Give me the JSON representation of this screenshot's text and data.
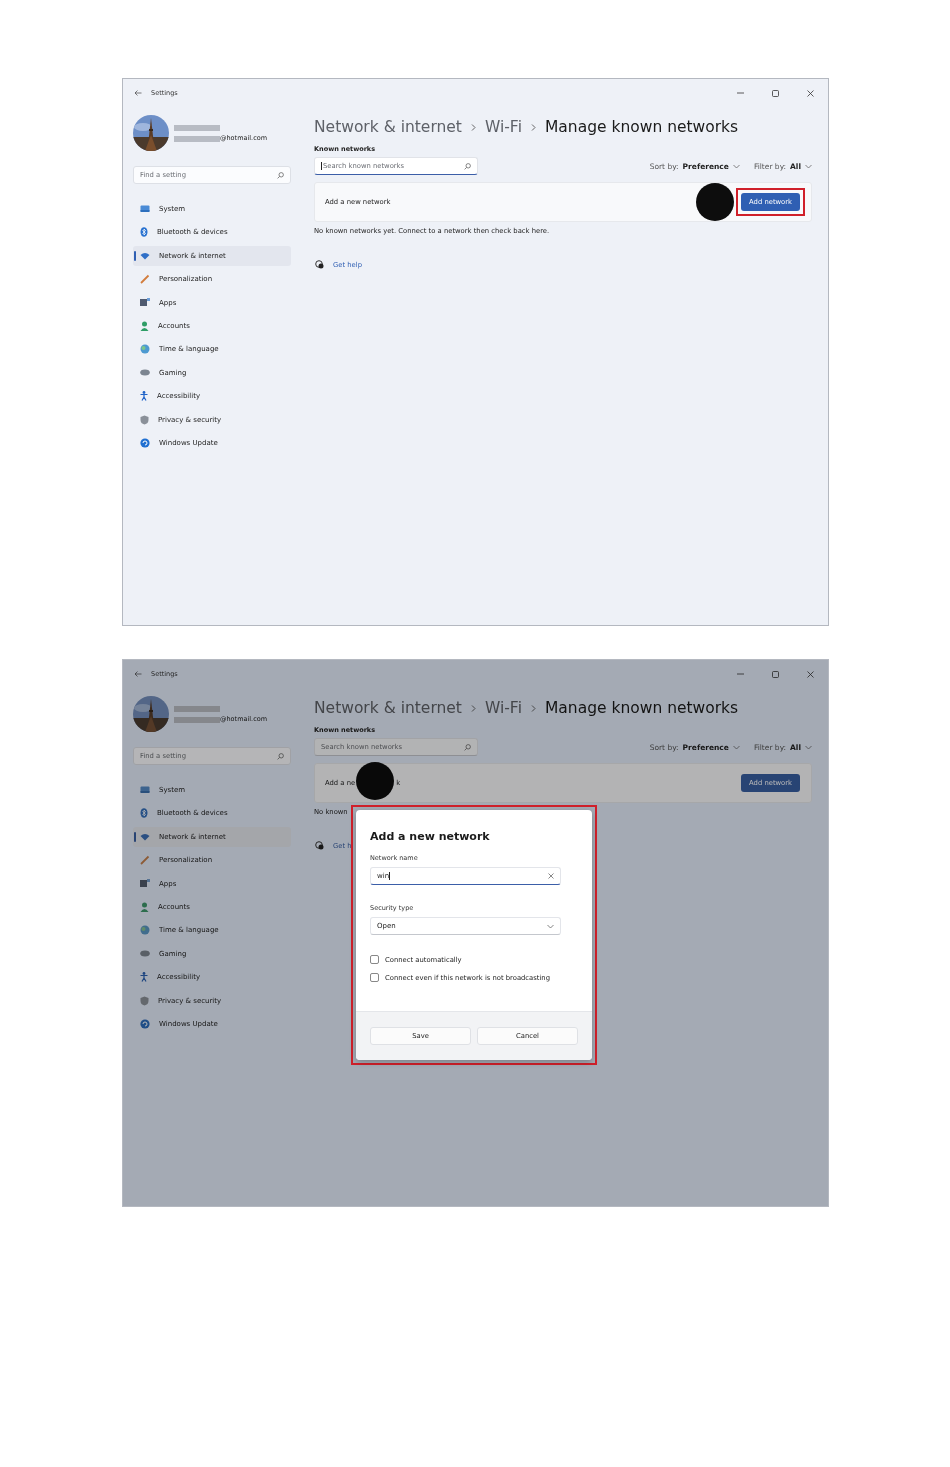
{
  "screens": [
    {
      "window": {
        "title": "Settings"
      },
      "account": {
        "email": "@hotmail.com"
      },
      "sidebar_search": {
        "placeholder": "Find a setting"
      },
      "nav": [
        {
          "label": "System",
          "selected": false
        },
        {
          "label": "Bluetooth & devices",
          "selected": false
        },
        {
          "label": "Network & internet",
          "selected": true
        },
        {
          "label": "Personalization",
          "selected": false
        },
        {
          "label": "Apps",
          "selected": false
        },
        {
          "label": "Accounts",
          "selected": false
        },
        {
          "label": "Time & language",
          "selected": false
        },
        {
          "label": "Gaming",
          "selected": false
        },
        {
          "label": "Accessibility",
          "selected": false
        },
        {
          "label": "Privacy & security",
          "selected": false
        },
        {
          "label": "Windows Update",
          "selected": false
        }
      ],
      "breadcrumb": [
        "Network & internet",
        "Wi-Fi",
        "Manage known networks"
      ],
      "section_title": "Known networks",
      "network_search": {
        "placeholder": "Search known networks",
        "focused": true
      },
      "sort": {
        "label": "Sort by:",
        "value": "Preference"
      },
      "filter": {
        "label": "Filter by:",
        "value": "All"
      },
      "add_row": {
        "label_parts": [
          "Add a new network"
        ],
        "button": {
          "label": "Add network",
          "highlighted": true,
          "marker": true
        }
      },
      "empty_message": "No known networks yet. Connect to a network then check back here.",
      "help": "Get help"
    },
    {
      "window": {
        "title": "Settings"
      },
      "account": {
        "email": "@hotmail.com"
      },
      "sidebar_search": {
        "placeholder": "Find a setting"
      },
      "nav": [
        {
          "label": "System",
          "selected": false
        },
        {
          "label": "Bluetooth & devices",
          "selected": false
        },
        {
          "label": "Network & internet",
          "selected": true
        },
        {
          "label": "Personalization",
          "selected": false
        },
        {
          "label": "Apps",
          "selected": false
        },
        {
          "label": "Accounts",
          "selected": false
        },
        {
          "label": "Time & language",
          "selected": false
        },
        {
          "label": "Gaming",
          "selected": false
        },
        {
          "label": "Accessibility",
          "selected": false
        },
        {
          "label": "Privacy & security",
          "selected": false
        },
        {
          "label": "Windows Update",
          "selected": false
        }
      ],
      "breadcrumb": [
        "Network & internet",
        "Wi-Fi",
        "Manage known networks"
      ],
      "section_title": "Known networks",
      "network_search": {
        "placeholder": "Search known networks",
        "focused": false
      },
      "sort": {
        "label": "Sort by:",
        "value": "Preference"
      },
      "filter": {
        "label": "Filter by:",
        "value": "All"
      },
      "add_row": {
        "label_parts": [
          "Add a ne",
          "k"
        ],
        "label_marker": true,
        "button": {
          "label": "Add network",
          "highlighted": false
        }
      },
      "empty_message": "No known",
      "help": "Get h",
      "dialog": {
        "title": "Add a new network",
        "highlighted": true,
        "name_field": {
          "label": "Network name",
          "value": "win",
          "focused": true
        },
        "security": {
          "label": "Security type",
          "value": "Open"
        },
        "options": [
          {
            "label": "Connect automatically",
            "checked": false
          },
          {
            "label": "Connect even if this network is not broadcasting",
            "checked": false
          }
        ],
        "buttons": [
          "Save",
          "Cancel"
        ]
      }
    }
  ]
}
